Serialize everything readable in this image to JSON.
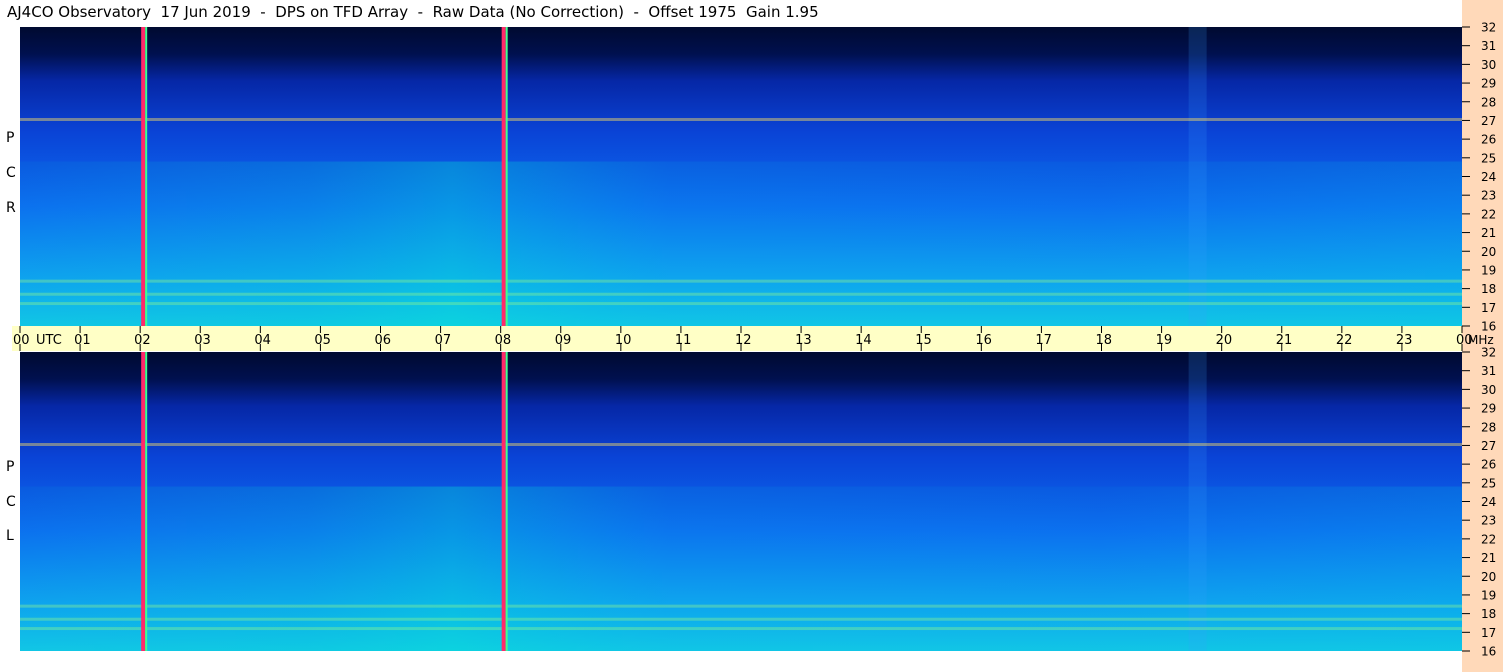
{
  "title": "AJ4CO Observatory  17 Jun 2019  -  DPS on TFD Array  -  Raw Data (No Correction)  -  Offset 1975  Gain 1.95",
  "panels": [
    {
      "label": [
        "R",
        "C",
        "P"
      ],
      "name": "rcp"
    },
    {
      "label": [
        "L",
        "C",
        "P"
      ],
      "name": "lcp"
    }
  ],
  "colors": {
    "time_bar": "#ffffc6",
    "freq_strip": "#ffd9b9",
    "background_deep": "#000a30",
    "background_mid": "#0a3cd8",
    "background_bright": "#10c8e0",
    "marker_line": "#ff2a6a"
  },
  "chart_data": {
    "type": "heatmap",
    "x_unit": "UTC hour",
    "x_ticks": [
      "00",
      "01",
      "02",
      "03",
      "04",
      "05",
      "06",
      "07",
      "08",
      "09",
      "10",
      "11",
      "12",
      "13",
      "14",
      "15",
      "16",
      "17",
      "18",
      "19",
      "20",
      "21",
      "22",
      "23",
      "00"
    ],
    "x_tick_suffix_utc": "UTC",
    "y_unit": "MHz",
    "y_ticks": [
      "32",
      "31",
      "30",
      "29",
      "28",
      "27",
      "26",
      "25",
      "24",
      "23",
      "22",
      "21",
      "20",
      "19",
      "18",
      "17",
      "16"
    ],
    "ylim": [
      16,
      32
    ],
    "xlim": [
      0,
      24
    ],
    "vertical_markers_utc": [
      2.05,
      8.05
    ],
    "interference_bands_mhz": [
      27.05,
      17.2,
      17.7,
      18.4
    ],
    "series": [
      {
        "name": "RCP"
      },
      {
        "name": "LCP"
      }
    ]
  }
}
